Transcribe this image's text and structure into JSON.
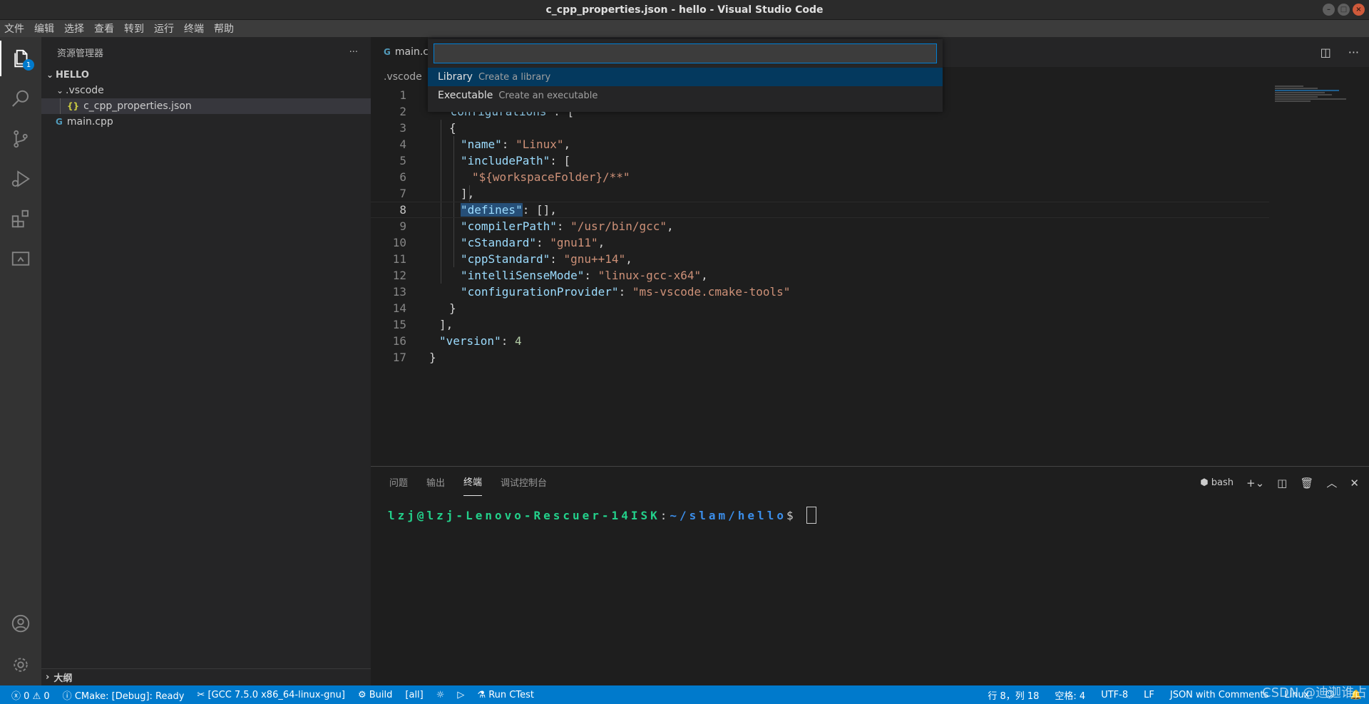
{
  "window": {
    "title": "c_cpp_properties.json - hello - Visual Studio Code"
  },
  "menu": [
    "文件",
    "编辑",
    "选择",
    "查看",
    "转到",
    "运行",
    "终端",
    "帮助"
  ],
  "activity": {
    "explorer_badge": "1"
  },
  "sidebar": {
    "title": "资源管理器",
    "more": "···",
    "root": "HELLO",
    "folder": ".vscode",
    "json_glyph": "{}",
    "cpp_glyph": "G",
    "file_json": "c_cpp_properties.json",
    "file_cpp": "main.cpp",
    "outline": "大纲"
  },
  "tab": {
    "label": "main.c"
  },
  "breadcrumb": ".vscode",
  "quickpick": {
    "placeholder": "",
    "items": [
      {
        "label": "Library",
        "desc": "Create a library"
      },
      {
        "label": "Executable",
        "desc": "Create an executable"
      }
    ]
  },
  "code": {
    "l2_key": "\"configurations\"",
    "l2_rest": ": [",
    "l3": "{",
    "l4_k": "\"name\"",
    "l4_v": "\"Linux\"",
    "l5_k": "\"includePath\"",
    "l5_rest": ": [",
    "l6_v": "\"${workspaceFolder}/**\"",
    "l7": "],",
    "l8_k": "\"defines\"",
    "l8_rest": ": [],",
    "l9_k": "\"compilerPath\"",
    "l9_v": "\"/usr/bin/gcc\"",
    "l10_k": "\"cStandard\"",
    "l10_v": "\"gnu11\"",
    "l11_k": "\"cppStandard\"",
    "l11_v": "\"gnu++14\"",
    "l12_k": "\"intelliSenseMode\"",
    "l12_v": "\"linux-gcc-x64\"",
    "l13_k": "\"configurationProvider\"",
    "l13_v": "\"ms-vscode.cmake-tools\"",
    "l14": "}",
    "l15": "],",
    "l16_k": "\"version\"",
    "l16_v": "4",
    "l17": "}",
    "sep_colon": ": ",
    "sep_comma": ","
  },
  "line_numbers": [
    "1",
    "2",
    "3",
    "4",
    "5",
    "6",
    "7",
    "8",
    "9",
    "10",
    "11",
    "12",
    "13",
    "14",
    "15",
    "16",
    "17"
  ],
  "panel": {
    "tabs": [
      "问题",
      "输出",
      "终端",
      "调试控制台"
    ],
    "shell": "bash"
  },
  "terminal": {
    "user": "lzj@lzj-Lenovo-Rescuer-14ISK",
    "colon": ":",
    "path": "~/slam/hello",
    "prompt": "$"
  },
  "status": {
    "errors": "0",
    "warnings": "0",
    "cmake": "CMake: [Debug]: Ready",
    "kit": "[GCC 7.5.0 x86_64-linux-gnu]",
    "build": "Build",
    "target": "[all]",
    "ctest": "Run CTest",
    "position": "行 8，列 18",
    "spaces": "空格: 4",
    "encoding": "UTF-8",
    "eol": "LF",
    "language": "JSON with Comments",
    "platform": "Linux"
  },
  "watermark": "CSDN @迪迦谁占了",
  "colors": {
    "accent": "#007acc",
    "statusbar": "#007acc",
    "selection": "#04395e"
  }
}
